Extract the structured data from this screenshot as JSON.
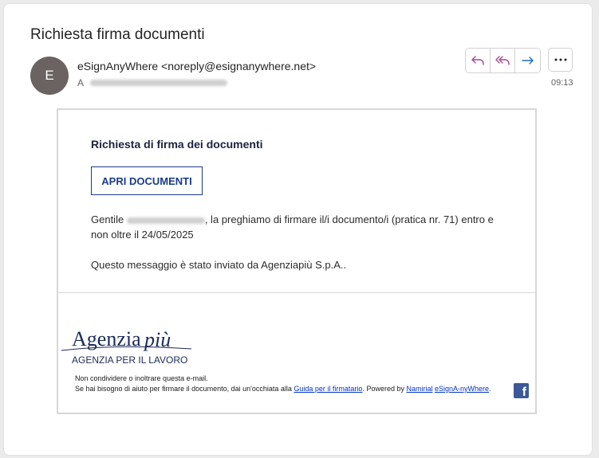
{
  "subject": "Richiesta firma documenti",
  "avatar_letter": "E",
  "sender": "eSignAnyWhere <noreply@esignanywhere.net>",
  "to_prefix": "A",
  "time": "09:13",
  "actions": {
    "reply_icon": "reply-icon",
    "reply_all_icon": "reply-all-icon",
    "forward_icon": "forward-icon",
    "more_icon": "more-icon"
  },
  "email": {
    "title": "Richiesta di firma dei documenti",
    "open_button": "APRI DOCUMENTI",
    "greeting": "Gentile",
    "body_text": ", la preghiamo di firmare il/i documento/i (pratica nr. 71) entro e non oltre il 24/05/2025",
    "sent_by": "Questo messaggio è stato inviato da Agenziapiù S.p.A..",
    "logo": {
      "brand_main": "Agenzia",
      "brand_script": "più",
      "tagline": "AGENZIA PER IL LAVORO"
    },
    "footer": {
      "line1": "Non condividere o inoltrare questa e-mail.",
      "line2_prefix": "Se hai bisogno di aiuto per firmare il documento, dai un'occhiata alla ",
      "guide_link": "Guida per il firmatario",
      "line2_mid": ". Powered by ",
      "namirial_link": "Namirial",
      "esign_link": "eSignA-nyWhere",
      "line2_end": "."
    },
    "facebook_icon": "facebook-icon"
  },
  "colors": {
    "accent_purple": "#a14a93",
    "accent_blue": "#1a3a8a",
    "facebook": "#3b5998"
  }
}
